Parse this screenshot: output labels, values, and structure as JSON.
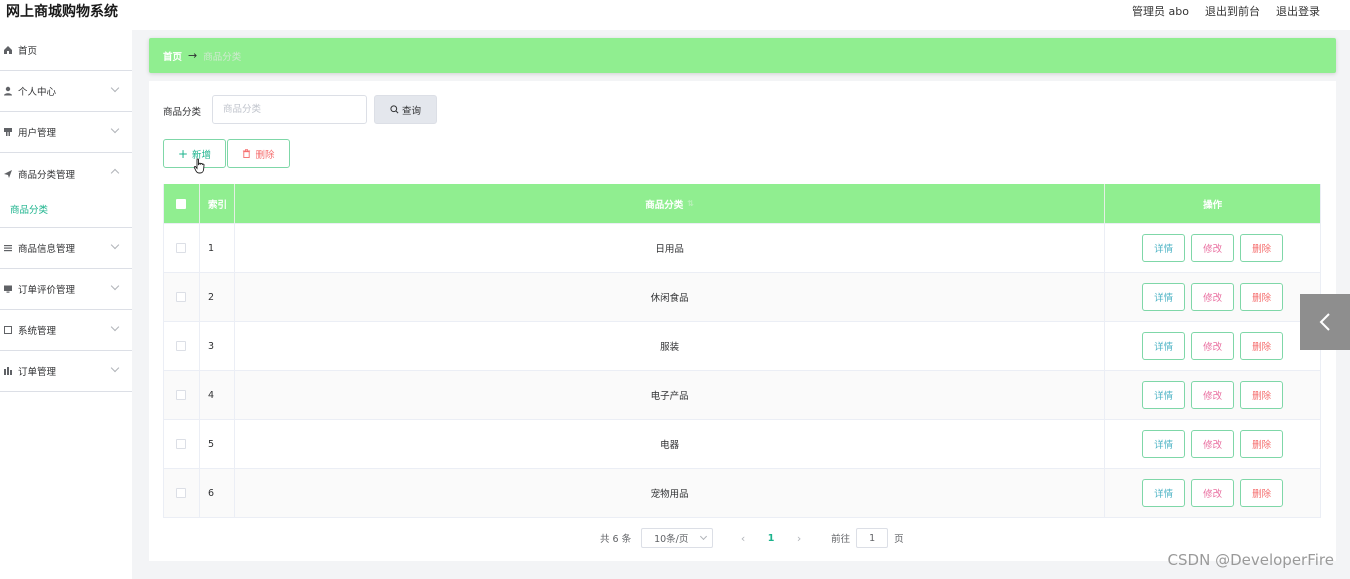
{
  "header": {
    "title": "网上商城购物系统",
    "admin": "管理员 abo",
    "to_front": "退出到前台",
    "logout": "退出登录"
  },
  "sidebar": {
    "items": [
      {
        "label": "首页",
        "icon": "home-icon"
      },
      {
        "label": "个人中心",
        "icon": "user-icon"
      },
      {
        "label": "用户管理",
        "icon": "users-icon"
      },
      {
        "label": "商品分类管理",
        "icon": "send-icon",
        "open": true,
        "sub": [
          "商品分类"
        ]
      },
      {
        "label": "商品信息管理",
        "icon": "list-icon"
      },
      {
        "label": "订单评价管理",
        "icon": "monitor-icon"
      },
      {
        "label": "系统管理",
        "icon": "window-icon"
      },
      {
        "label": "订单管理",
        "icon": "chart-icon"
      }
    ]
  },
  "breadcrumb": {
    "home": "首页",
    "current": "商品分类"
  },
  "search": {
    "label": "商品分类",
    "placeholder": "商品分类",
    "button": "查询"
  },
  "actions": {
    "add": "新增",
    "delete": "删除"
  },
  "table": {
    "headers": {
      "index": "索引",
      "category": "商品分类",
      "ops": "操作"
    },
    "rows": [
      {
        "index": "1",
        "category": "日用品"
      },
      {
        "index": "2",
        "category": "休闲食品"
      },
      {
        "index": "3",
        "category": "服装"
      },
      {
        "index": "4",
        "category": "电子产品"
      },
      {
        "index": "5",
        "category": "电器"
      },
      {
        "index": "6",
        "category": "宠物用品"
      }
    ],
    "row_actions": {
      "detail": "详情",
      "edit": "修改",
      "delete": "删除"
    }
  },
  "pager": {
    "total": "共 6 条",
    "page_size": "10条/页",
    "current_page": "1",
    "goto_label": "前往",
    "goto_value": "1",
    "page_suffix": "页"
  },
  "watermark": "CSDN @DeveloperFire",
  "colors": {
    "accent": "#90ee90",
    "primary": "#1bb38c",
    "danger": "#f56c6c"
  }
}
